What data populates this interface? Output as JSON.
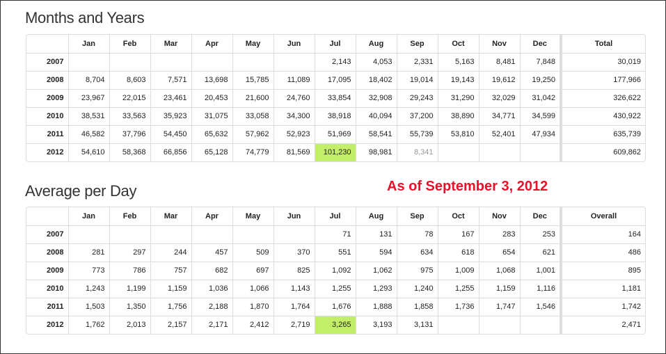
{
  "months_years": {
    "title": "Months and Years",
    "headers": [
      "",
      "Jan",
      "Feb",
      "Mar",
      "Apr",
      "May",
      "Jun",
      "Jul",
      "Aug",
      "Sep",
      "Oct",
      "Nov",
      "Dec",
      "Total"
    ],
    "rows": [
      [
        "2007",
        "",
        "",
        "",
        "",
        "",
        "",
        "2,143",
        "4,053",
        "2,331",
        "5,163",
        "8,481",
        "7,848",
        "30,019"
      ],
      [
        "2008",
        "8,704",
        "8,603",
        "7,571",
        "13,698",
        "15,785",
        "11,089",
        "17,095",
        "18,402",
        "19,014",
        "19,143",
        "19,612",
        "19,250",
        "177,966"
      ],
      [
        "2009",
        "23,967",
        "22,015",
        "23,461",
        "20,453",
        "21,600",
        "24,760",
        "33,854",
        "32,908",
        "29,243",
        "31,290",
        "32,029",
        "31,042",
        "326,622"
      ],
      [
        "2010",
        "38,531",
        "33,563",
        "35,923",
        "31,075",
        "33,058",
        "34,300",
        "38,918",
        "40,094",
        "37,200",
        "38,890",
        "34,771",
        "34,599",
        "430,922"
      ],
      [
        "2011",
        "46,582",
        "37,796",
        "54,450",
        "65,632",
        "57,962",
        "52,923",
        "51,969",
        "58,541",
        "55,739",
        "53,810",
        "52,401",
        "47,934",
        "635,739"
      ],
      [
        "2012",
        "54,610",
        "58,368",
        "66,856",
        "65,128",
        "74,779",
        "81,569",
        "101,230",
        "98,981",
        "8,341",
        "",
        "",
        "",
        "609,862"
      ]
    ]
  },
  "average_per_day": {
    "title": "Average per Day",
    "headers": [
      "",
      "Jan",
      "Feb",
      "Mar",
      "Apr",
      "May",
      "Jun",
      "Jul",
      "Aug",
      "Sep",
      "Oct",
      "Nov",
      "Dec",
      "Overall"
    ],
    "rows": [
      [
        "2007",
        "",
        "",
        "",
        "",
        "",
        "",
        "71",
        "131",
        "78",
        "167",
        "283",
        "253",
        "164"
      ],
      [
        "2008",
        "281",
        "297",
        "244",
        "457",
        "509",
        "370",
        "551",
        "594",
        "634",
        "618",
        "654",
        "621",
        "486"
      ],
      [
        "2009",
        "773",
        "786",
        "757",
        "682",
        "697",
        "825",
        "1,092",
        "1,062",
        "975",
        "1,009",
        "1,068",
        "1,001",
        "895"
      ],
      [
        "2010",
        "1,243",
        "1,199",
        "1,159",
        "1,036",
        "1,066",
        "1,143",
        "1,255",
        "1,293",
        "1,240",
        "1,255",
        "1,159",
        "1,116",
        "1,181"
      ],
      [
        "2011",
        "1,503",
        "1,350",
        "1,756",
        "2,188",
        "1,870",
        "1,764",
        "1,676",
        "1,888",
        "1,858",
        "1,736",
        "1,747",
        "1,546",
        "1,742"
      ],
      [
        "2012",
        "1,762",
        "2,013",
        "2,157",
        "2,171",
        "2,412",
        "2,719",
        "3,265",
        "3,193",
        "3,131",
        "",
        "",
        "",
        "2,471"
      ]
    ]
  },
  "note": "As of September 3, 2012",
  "colors": {
    "highlight": "#c2ee6a",
    "note_red": "#e8102a",
    "muted_text": "#999999"
  },
  "highlight_cells": [
    {
      "table": "months_years",
      "row": 5,
      "col": 7
    },
    {
      "table": "average_per_day",
      "row": 5,
      "col": 7
    }
  ],
  "muted_cells": [
    {
      "table": "months_years",
      "row": 5,
      "col": 9
    }
  ]
}
